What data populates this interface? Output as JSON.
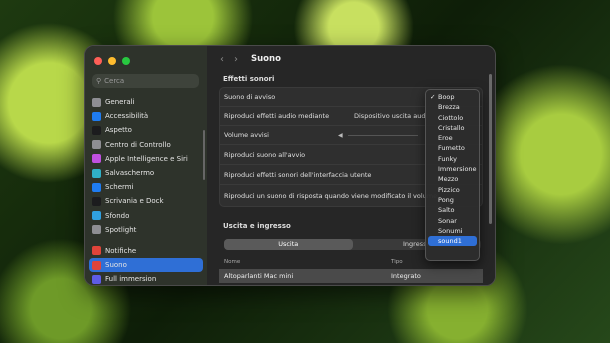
{
  "search": {
    "placeholder": "Cerca"
  },
  "sidebar": {
    "items": [
      {
        "label": "Generali",
        "icon": "gear-icon",
        "color": "#8e8e93"
      },
      {
        "label": "Accessibilità",
        "icon": "accessibility-icon",
        "color": "#1f7cf1"
      },
      {
        "label": "Aspetto",
        "icon": "appearance-icon",
        "color": "#1c1c1e"
      },
      {
        "label": "Centro di Controllo",
        "icon": "control-center-icon",
        "color": "#8e8e93"
      },
      {
        "label": "Apple Intelligence e Siri",
        "icon": "siri-icon",
        "color": "#c050e0"
      },
      {
        "label": "Salvaschermo",
        "icon": "screensaver-icon",
        "color": "#30b0c7"
      },
      {
        "label": "Schermi",
        "icon": "display-icon",
        "color": "#1f7cf1"
      },
      {
        "label": "Scrivania e Dock",
        "icon": "dock-icon",
        "color": "#1c1c1e"
      },
      {
        "label": "Sfondo",
        "icon": "wallpaper-icon",
        "color": "#30a0e0"
      },
      {
        "label": "Spotlight",
        "icon": "spotlight-icon",
        "color": "#8e8e93"
      }
    ],
    "items2": [
      {
        "label": "Notifiche",
        "icon": "notifications-icon",
        "color": "#e0443a"
      },
      {
        "label": "Suono",
        "icon": "sound-icon",
        "color": "#e0443a",
        "active": true
      },
      {
        "label": "Full immersion",
        "icon": "focus-icon",
        "color": "#5e5ce6"
      }
    ]
  },
  "header": {
    "title": "Suono"
  },
  "effects": {
    "title": "Effetti sonori",
    "alert_sound": "Suono di avviso",
    "play_through": "Riproduci effetti audio mediante",
    "play_through_value": "Dispositivo uscita aud",
    "alert_volume": "Volume avvisi",
    "startup": "Riproduci suono all'avvio",
    "ui_effects": "Riproduci effetti sonori dell'interfaccia utente",
    "feedback": "Riproduci un suono di risposta quando viene modificato il volume"
  },
  "io": {
    "title": "Uscita e ingresso",
    "tab_output": "Uscita",
    "tab_input": "Ingresso",
    "col_name": "Nome",
    "col_type": "Tipo",
    "rows": [
      {
        "name": "Altoparlanti Mac mini",
        "type": "Integrato"
      }
    ]
  },
  "dropdown": {
    "selected": "Boop",
    "highlighted": "sound1",
    "options": [
      "Boop",
      "Brezza",
      "Ciottolo",
      "Cristallo",
      "Eroe",
      "Fumetto",
      "Funky",
      "Immersione",
      "Mezzo",
      "Pizzico",
      "Pong",
      "Salto",
      "Sonar",
      "Sonumi",
      "sound1"
    ]
  }
}
